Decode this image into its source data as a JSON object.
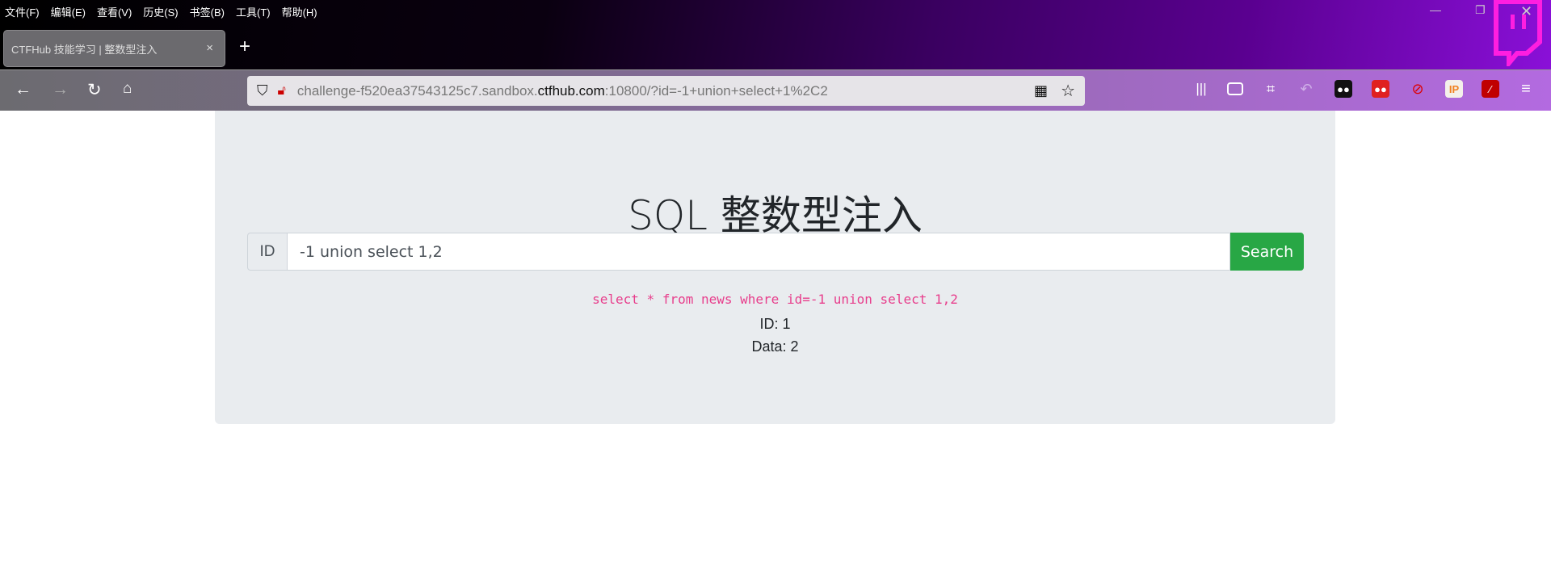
{
  "browser": {
    "menu": [
      "文件(F)",
      "编辑(E)",
      "查看(V)",
      "历史(S)",
      "书签(B)",
      "工具(T)",
      "帮助(H)"
    ],
    "tab_title": "CTFHub 技能学习 | 整数型注入",
    "tab_close": "×",
    "new_tab": "+",
    "url": {
      "prefix": "challenge-f520ea37543125c7.sandbox.",
      "host": "ctfhub.com",
      "suffix": ":10800/?id=-1+union+select+1%2C2"
    },
    "extensions": [
      "library",
      "sidebar",
      "screenshot-crop",
      "undo",
      "ghostery",
      "tampermonkey",
      "no-script",
      "ip",
      "wizard",
      "menu"
    ]
  },
  "page": {
    "title": "SQL 整数型注入",
    "id_label": "ID",
    "id_value": "-1 union select 1,2",
    "search_label": "Search",
    "sql": "select * from news where id=-1 union select 1,2",
    "result_id": "ID: 1",
    "result_data": "Data: 2"
  },
  "colors": {
    "accent": "#28a745",
    "sql": "#e83e8c",
    "panel": "#e9ecef"
  }
}
